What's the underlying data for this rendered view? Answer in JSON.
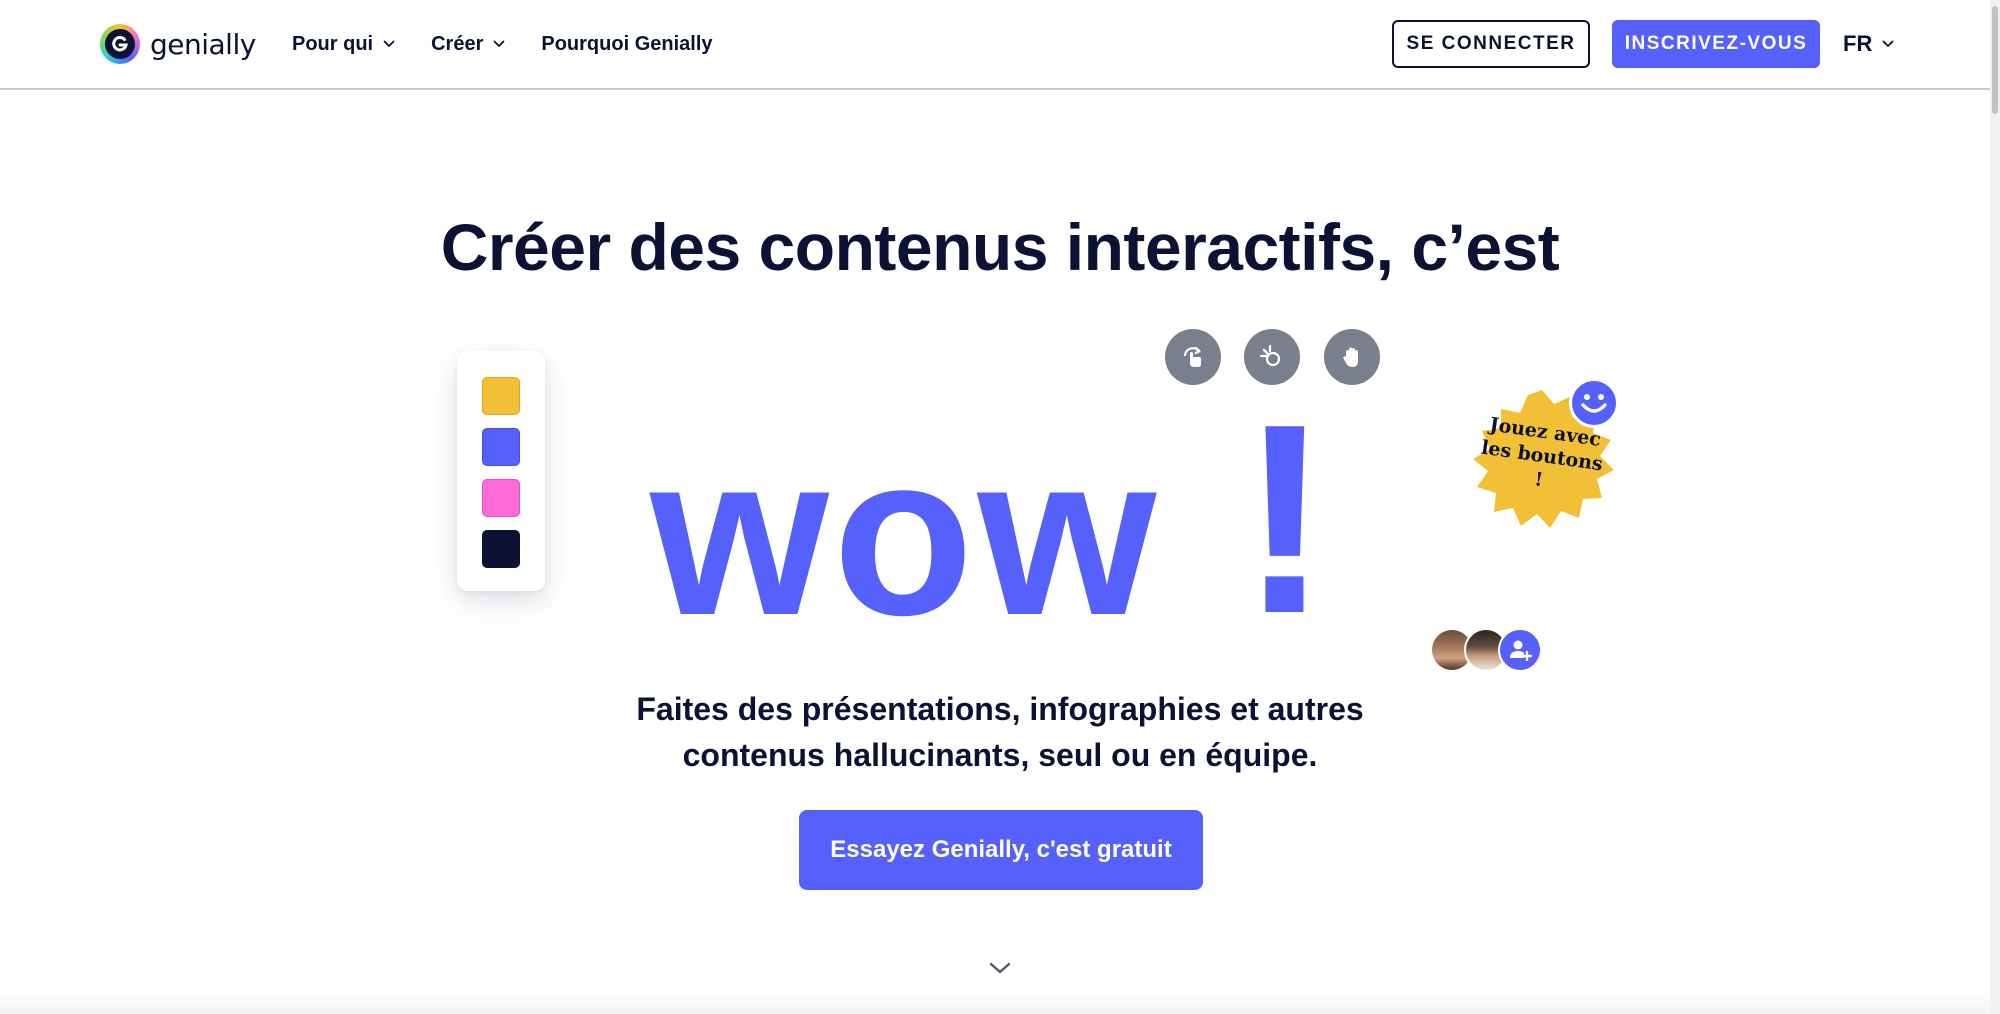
{
  "header": {
    "logo_text": "genially",
    "nav": [
      {
        "label": "Pour qui",
        "has_dropdown": true
      },
      {
        "label": "Créer",
        "has_dropdown": true
      },
      {
        "label": "Pourquoi Genially",
        "has_dropdown": false
      }
    ],
    "login_label": "SE CONNECTER",
    "signup_label": "INSCRIVEZ-VOUS",
    "language": "FR"
  },
  "hero": {
    "title": "Créer des contenus interactifs, c’est",
    "wow_word": "wow",
    "wow_punct": "!",
    "palette": [
      {
        "name": "yellow",
        "color": "#f2c037"
      },
      {
        "name": "blue",
        "color": "#5660fb"
      },
      {
        "name": "pink",
        "color": "#ff6bd6"
      },
      {
        "name": "navy",
        "color": "#0b1233"
      }
    ],
    "tools": [
      "rotate-icon",
      "click-icon",
      "hand-icon"
    ],
    "badge_text": "Jouez avec les boutons !",
    "subtitle_line1": "Faites des présentations, infographies et autres",
    "subtitle_line2": "contenus hallucinants, seul ou en équipe.",
    "cta_label": "Essayez Genially, c'est gratuit"
  },
  "colors": {
    "accent": "#5660fb",
    "navy": "#0b1233",
    "yellow": "#f2c037",
    "pink": "#ff6bd6",
    "tool_gray": "#7a7f8e"
  }
}
